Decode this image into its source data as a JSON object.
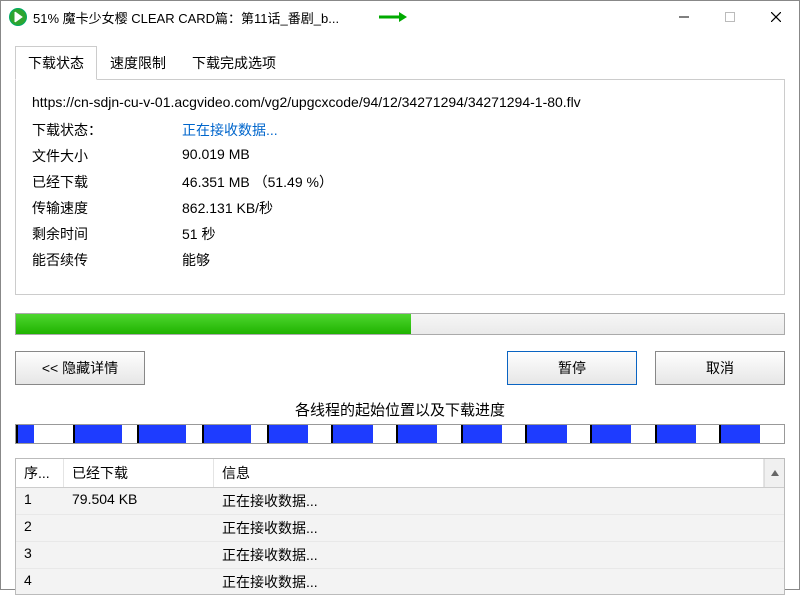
{
  "window": {
    "title": "51% 魔卡少女樱 CLEAR CARD篇：第11话_番剧_b..."
  },
  "tabs": {
    "status": "下载状态",
    "speed_limit": "速度限制",
    "done_opts": "下载完成选项"
  },
  "panel": {
    "url": "https://cn-sdjn-cu-v-01.acgvideo.com/vg2/upgcxcode/94/12/34271294/34271294-1-80.flv",
    "labels": {
      "status": "下载状态：",
      "file_size": "文件大小",
      "downloaded": "已经下载",
      "speed": "传输速度",
      "remaining": "剩余时间",
      "resumable": "能否续传"
    },
    "values": {
      "status": "正在接收数据...",
      "file_size": "90.019  MB",
      "downloaded": "46.351  MB （51.49 %）",
      "speed": "862.131  KB/秒",
      "remaining": "51 秒",
      "resumable": "能够"
    }
  },
  "progress_percent": 51.49,
  "buttons": {
    "hide": "<<  隐藏详情",
    "pause": "暂停",
    "cancel": "取消"
  },
  "threads_title": "各线程的起始位置以及下载进度",
  "table": {
    "headers": {
      "index": "序...",
      "downloaded": "已经下载",
      "info": "信息"
    },
    "rows": [
      {
        "i": "1",
        "dl": "79.504  KB",
        "info": "正在接收数据..."
      },
      {
        "i": "2",
        "dl": "",
        "info": "正在接收数据..."
      },
      {
        "i": "3",
        "dl": "",
        "info": "正在接收数据..."
      },
      {
        "i": "4",
        "dl": "",
        "info": "正在接收数据..."
      }
    ]
  },
  "segments": [
    {
      "t": "start"
    },
    {
      "t": "dl",
      "w": 2
    },
    {
      "t": "gap",
      "w": 5
    },
    {
      "t": "start"
    },
    {
      "t": "dl",
      "w": 6
    },
    {
      "t": "gap",
      "w": 2
    },
    {
      "t": "start"
    },
    {
      "t": "dl",
      "w": 6
    },
    {
      "t": "gap",
      "w": 2
    },
    {
      "t": "start"
    },
    {
      "t": "dl",
      "w": 6
    },
    {
      "t": "gap",
      "w": 2
    },
    {
      "t": "start"
    },
    {
      "t": "dl",
      "w": 5
    },
    {
      "t": "gap",
      "w": 3
    },
    {
      "t": "start"
    },
    {
      "t": "dl",
      "w": 5
    },
    {
      "t": "gap",
      "w": 3
    },
    {
      "t": "start"
    },
    {
      "t": "dl",
      "w": 5
    },
    {
      "t": "gap",
      "w": 3
    },
    {
      "t": "start"
    },
    {
      "t": "dl",
      "w": 5
    },
    {
      "t": "gap",
      "w": 3
    },
    {
      "t": "start"
    },
    {
      "t": "dl",
      "w": 5
    },
    {
      "t": "gap",
      "w": 3
    },
    {
      "t": "start"
    },
    {
      "t": "dl",
      "w": 5
    },
    {
      "t": "gap",
      "w": 3
    },
    {
      "t": "start"
    },
    {
      "t": "dl",
      "w": 5
    },
    {
      "t": "gap",
      "w": 3
    },
    {
      "t": "start"
    },
    {
      "t": "dl",
      "w": 5
    },
    {
      "t": "gap",
      "w": 3
    }
  ]
}
